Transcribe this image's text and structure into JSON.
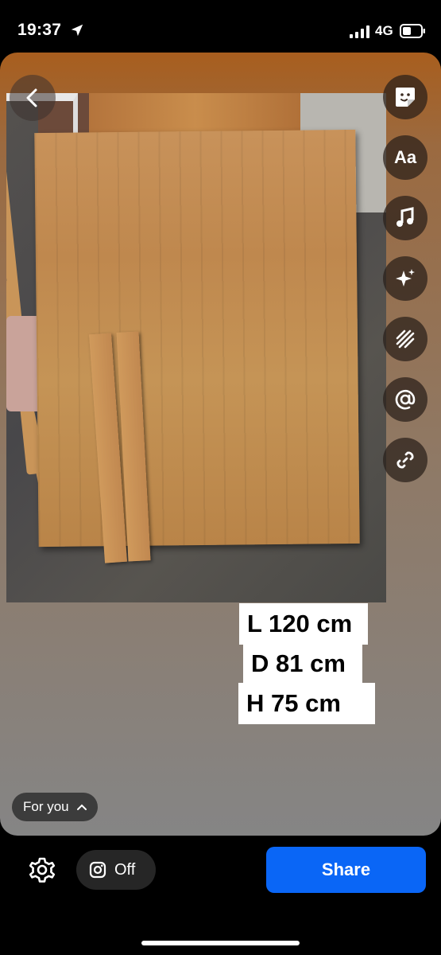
{
  "status_bar": {
    "time": "19:37",
    "network": "4G",
    "icons": [
      "location-arrow-icon",
      "signal-icon",
      "battery-icon"
    ]
  },
  "story": {
    "dimension_labels": [
      "L 120 cm",
      "D 81 cm",
      "H 75 cm"
    ],
    "tool_icons": [
      "sticker-icon",
      "text-icon",
      "music-icon",
      "effects-icon",
      "draw-icon",
      "mention-icon",
      "link-icon"
    ],
    "text_tool_label": "Aa",
    "audience_label": "For you"
  },
  "bottom_bar": {
    "instagram_toggle_label": "Off",
    "share_label": "Share"
  },
  "colors": {
    "share_button": "#0a66f6",
    "pill_background": "#262626"
  }
}
